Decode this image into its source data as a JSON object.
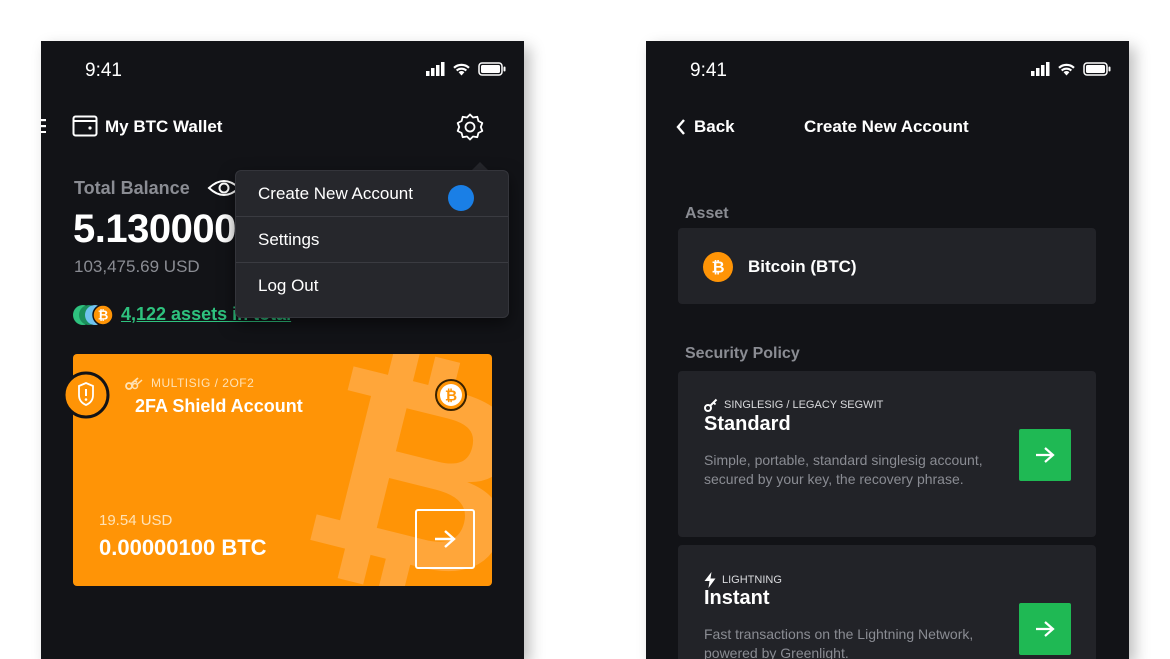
{
  "left_screen": {
    "status_time": "9:41",
    "header": {
      "title": "My BTC Wallet"
    },
    "balance": {
      "label": "Total Balance",
      "btc_value": "5.130000",
      "usd_value": "103,475.69 USD"
    },
    "assets_link": "4,122 assets in total",
    "dropdown": {
      "items": [
        {
          "label": "Create New Account"
        },
        {
          "label": "Settings"
        },
        {
          "label": "Log Out"
        }
      ]
    },
    "card": {
      "tag": "MULTISIG / 2OF2",
      "name": "2FA Shield Account",
      "usd": "19.54 USD",
      "btc": "0.00000100 BTC"
    }
  },
  "right_screen": {
    "status_time": "9:41",
    "back_label": "Back",
    "title": "Create New Account",
    "asset_section_label": "Asset",
    "asset_name": "Bitcoin (BTC)",
    "security_section_label": "Security Policy",
    "policies": [
      {
        "tag": "SINGLESIG / LEGACY SEGWIT",
        "title": "Standard",
        "description": "Simple, portable, standard singlesig account, secured by your key, the recovery phrase."
      },
      {
        "tag": "LIGHTNING",
        "title": "Instant",
        "description": "Fast transactions on the Lightning Network, powered by Greenlight."
      }
    ]
  },
  "colors": {
    "background": "#121317",
    "surface": "#222328",
    "card_orange": "#ff9406",
    "accent_green": "#1fb954",
    "link_green": "#2ec27e",
    "dot_blue": "#1a7fe6",
    "muted_text": "#8a8c93"
  }
}
